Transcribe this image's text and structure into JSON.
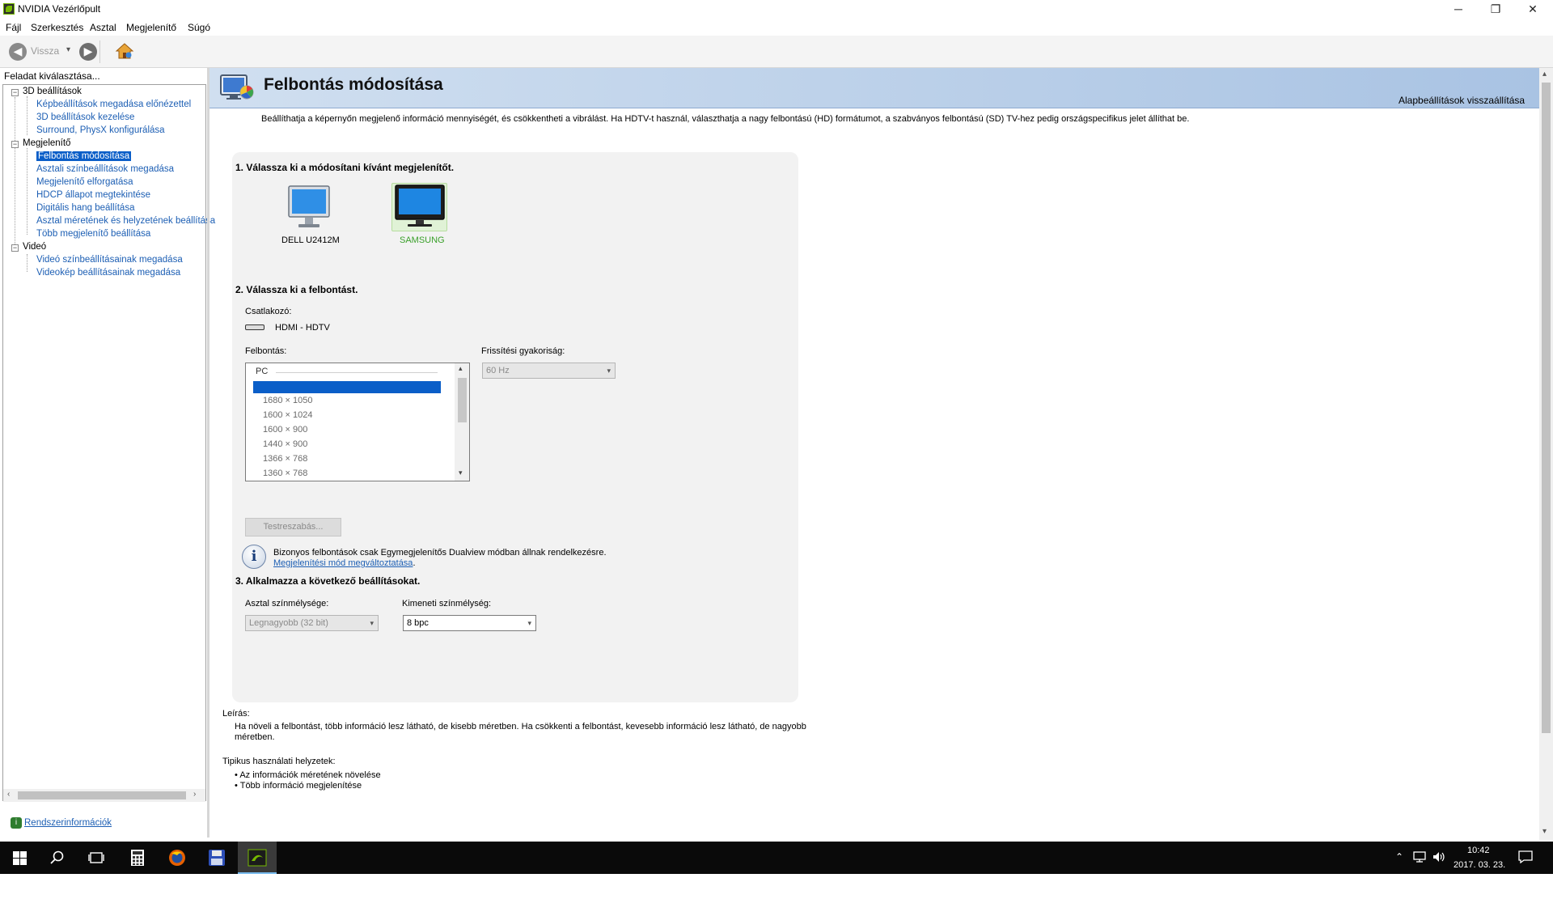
{
  "window": {
    "title": "NVIDIA Vezérlőpult",
    "minimize": "─",
    "maximize": "❐",
    "close": "✕"
  },
  "menu": [
    "Fájl",
    "Szerkesztés",
    "Asztal",
    "Megjelenítő",
    "Súgó"
  ],
  "toolbar": {
    "back_label": "Vissza",
    "back_arrow": "◀",
    "forward_arrow": "▶",
    "dropdown": "▾"
  },
  "left": {
    "task_label": "Feladat kiválasztása...",
    "tree": [
      {
        "label": "3D beállítások",
        "type": "category"
      },
      {
        "label": "Képbeállítások megadása előnézettel",
        "type": "link"
      },
      {
        "label": "3D beállítások kezelése",
        "type": "link"
      },
      {
        "label": "Surround, PhysX konfigurálása",
        "type": "link"
      },
      {
        "label": "Megjelenítő",
        "type": "category"
      },
      {
        "label": "Felbontás módosítása",
        "type": "link",
        "selected": true
      },
      {
        "label": "Asztali színbeállítások megadása",
        "type": "link"
      },
      {
        "label": "Megjelenítő elforgatása",
        "type": "link"
      },
      {
        "label": "HDCP állapot megtekintése",
        "type": "link"
      },
      {
        "label": "Digitális hang beállítása",
        "type": "link"
      },
      {
        "label": "Asztal méretének és helyzetének beállítása",
        "type": "link"
      },
      {
        "label": "Több megjelenítő beállítása",
        "type": "link"
      },
      {
        "label": "Videó",
        "type": "category"
      },
      {
        "label": "Videó színbeállításainak megadása",
        "type": "link"
      },
      {
        "label": "Videokép beállításainak megadása",
        "type": "link"
      }
    ],
    "system_info": "Rendszerinformációk"
  },
  "header": {
    "title": "Felbontás módosítása",
    "restore_defaults": "Alapbeállítások visszaállítása",
    "intro": "Beállíthatja a képernyőn megjelenő információ mennyiségét, és csökkentheti a vibrálást. Ha HDTV-t használ, választhatja a nagy felbontású (HD) formátumot, a szabványos felbontású (SD) TV-hez pedig országspecifikus jelet állíthat be."
  },
  "step1": {
    "title": "1. Válassza ki a módosítani kívánt megjelenítőt.",
    "displays": [
      {
        "name": "DELL U2412M",
        "selected": false
      },
      {
        "name": "SAMSUNG",
        "selected": true
      }
    ],
    "selected_color": "#3aa02a"
  },
  "step2": {
    "title": "2. Válassza ki a felbontást.",
    "connector_label": "Csatlakozó:",
    "connector_value": "HDMI - HDTV",
    "resolution_label": "Felbontás:",
    "refresh_label": "Frissítési gyakoriság:",
    "refresh_value": "60 Hz",
    "list_group": "PC",
    "resolutions": [
      "1680 × 1050",
      "1600 × 1024",
      "1600 × 900",
      "1440 × 900",
      "1366 × 768",
      "1360 × 768"
    ],
    "customize_button": "Testreszabás...",
    "info_text": "Bizonyos felbontások csak Egymegjelenítős Dualview módban állnak rendelkezésre. ",
    "info_link": "Megjelenítési mód megváltoztatása",
    "info_end": "."
  },
  "step3": {
    "title": "3. Alkalmazza a következő beállításokat.",
    "desktop_depth_label": "Asztal színmélysége:",
    "desktop_depth_value": "Legnagyobb (32 bit)",
    "output_depth_label": "Kimeneti színmélység:",
    "output_depth_value": "8 bpc"
  },
  "description": {
    "label": "Leírás:",
    "text": "Ha növeli a felbontást, több információ lesz látható, de kisebb méretben. Ha csökkenti a felbontást, kevesebb információ lesz látható, de nagyobb méretben.",
    "uses_label": "Tipikus használati helyzetek:",
    "uses": [
      "Az információk méretének növelése",
      "Több információ megjelenítése"
    ]
  },
  "taskbar": {
    "time": "10:42",
    "date": "2017. 03. 23."
  },
  "colors": {
    "accent": "#0a5ec8",
    "link": "#1d5fb4",
    "nvidia_green": "#76b900"
  }
}
